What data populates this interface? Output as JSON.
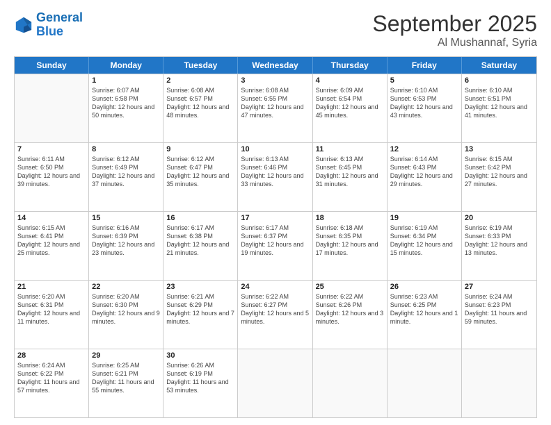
{
  "header": {
    "logo_line1": "General",
    "logo_line2": "Blue",
    "month": "September 2025",
    "location": "Al Mushannaf, Syria"
  },
  "days_of_week": [
    "Sunday",
    "Monday",
    "Tuesday",
    "Wednesday",
    "Thursday",
    "Friday",
    "Saturday"
  ],
  "weeks": [
    [
      {
        "day": "",
        "sunrise": "",
        "sunset": "",
        "daylight": ""
      },
      {
        "day": "1",
        "sunrise": "Sunrise: 6:07 AM",
        "sunset": "Sunset: 6:58 PM",
        "daylight": "Daylight: 12 hours and 50 minutes."
      },
      {
        "day": "2",
        "sunrise": "Sunrise: 6:08 AM",
        "sunset": "Sunset: 6:57 PM",
        "daylight": "Daylight: 12 hours and 48 minutes."
      },
      {
        "day": "3",
        "sunrise": "Sunrise: 6:08 AM",
        "sunset": "Sunset: 6:55 PM",
        "daylight": "Daylight: 12 hours and 47 minutes."
      },
      {
        "day": "4",
        "sunrise": "Sunrise: 6:09 AM",
        "sunset": "Sunset: 6:54 PM",
        "daylight": "Daylight: 12 hours and 45 minutes."
      },
      {
        "day": "5",
        "sunrise": "Sunrise: 6:10 AM",
        "sunset": "Sunset: 6:53 PM",
        "daylight": "Daylight: 12 hours and 43 minutes."
      },
      {
        "day": "6",
        "sunrise": "Sunrise: 6:10 AM",
        "sunset": "Sunset: 6:51 PM",
        "daylight": "Daylight: 12 hours and 41 minutes."
      }
    ],
    [
      {
        "day": "7",
        "sunrise": "Sunrise: 6:11 AM",
        "sunset": "Sunset: 6:50 PM",
        "daylight": "Daylight: 12 hours and 39 minutes."
      },
      {
        "day": "8",
        "sunrise": "Sunrise: 6:12 AM",
        "sunset": "Sunset: 6:49 PM",
        "daylight": "Daylight: 12 hours and 37 minutes."
      },
      {
        "day": "9",
        "sunrise": "Sunrise: 6:12 AM",
        "sunset": "Sunset: 6:47 PM",
        "daylight": "Daylight: 12 hours and 35 minutes."
      },
      {
        "day": "10",
        "sunrise": "Sunrise: 6:13 AM",
        "sunset": "Sunset: 6:46 PM",
        "daylight": "Daylight: 12 hours and 33 minutes."
      },
      {
        "day": "11",
        "sunrise": "Sunrise: 6:13 AM",
        "sunset": "Sunset: 6:45 PM",
        "daylight": "Daylight: 12 hours and 31 minutes."
      },
      {
        "day": "12",
        "sunrise": "Sunrise: 6:14 AM",
        "sunset": "Sunset: 6:43 PM",
        "daylight": "Daylight: 12 hours and 29 minutes."
      },
      {
        "day": "13",
        "sunrise": "Sunrise: 6:15 AM",
        "sunset": "Sunset: 6:42 PM",
        "daylight": "Daylight: 12 hours and 27 minutes."
      }
    ],
    [
      {
        "day": "14",
        "sunrise": "Sunrise: 6:15 AM",
        "sunset": "Sunset: 6:41 PM",
        "daylight": "Daylight: 12 hours and 25 minutes."
      },
      {
        "day": "15",
        "sunrise": "Sunrise: 6:16 AM",
        "sunset": "Sunset: 6:39 PM",
        "daylight": "Daylight: 12 hours and 23 minutes."
      },
      {
        "day": "16",
        "sunrise": "Sunrise: 6:17 AM",
        "sunset": "Sunset: 6:38 PM",
        "daylight": "Daylight: 12 hours and 21 minutes."
      },
      {
        "day": "17",
        "sunrise": "Sunrise: 6:17 AM",
        "sunset": "Sunset: 6:37 PM",
        "daylight": "Daylight: 12 hours and 19 minutes."
      },
      {
        "day": "18",
        "sunrise": "Sunrise: 6:18 AM",
        "sunset": "Sunset: 6:35 PM",
        "daylight": "Daylight: 12 hours and 17 minutes."
      },
      {
        "day": "19",
        "sunrise": "Sunrise: 6:19 AM",
        "sunset": "Sunset: 6:34 PM",
        "daylight": "Daylight: 12 hours and 15 minutes."
      },
      {
        "day": "20",
        "sunrise": "Sunrise: 6:19 AM",
        "sunset": "Sunset: 6:33 PM",
        "daylight": "Daylight: 12 hours and 13 minutes."
      }
    ],
    [
      {
        "day": "21",
        "sunrise": "Sunrise: 6:20 AM",
        "sunset": "Sunset: 6:31 PM",
        "daylight": "Daylight: 12 hours and 11 minutes."
      },
      {
        "day": "22",
        "sunrise": "Sunrise: 6:20 AM",
        "sunset": "Sunset: 6:30 PM",
        "daylight": "Daylight: 12 hours and 9 minutes."
      },
      {
        "day": "23",
        "sunrise": "Sunrise: 6:21 AM",
        "sunset": "Sunset: 6:29 PM",
        "daylight": "Daylight: 12 hours and 7 minutes."
      },
      {
        "day": "24",
        "sunrise": "Sunrise: 6:22 AM",
        "sunset": "Sunset: 6:27 PM",
        "daylight": "Daylight: 12 hours and 5 minutes."
      },
      {
        "day": "25",
        "sunrise": "Sunrise: 6:22 AM",
        "sunset": "Sunset: 6:26 PM",
        "daylight": "Daylight: 12 hours and 3 minutes."
      },
      {
        "day": "26",
        "sunrise": "Sunrise: 6:23 AM",
        "sunset": "Sunset: 6:25 PM",
        "daylight": "Daylight: 12 hours and 1 minute."
      },
      {
        "day": "27",
        "sunrise": "Sunrise: 6:24 AM",
        "sunset": "Sunset: 6:23 PM",
        "daylight": "Daylight: 11 hours and 59 minutes."
      }
    ],
    [
      {
        "day": "28",
        "sunrise": "Sunrise: 6:24 AM",
        "sunset": "Sunset: 6:22 PM",
        "daylight": "Daylight: 11 hours and 57 minutes."
      },
      {
        "day": "29",
        "sunrise": "Sunrise: 6:25 AM",
        "sunset": "Sunset: 6:21 PM",
        "daylight": "Daylight: 11 hours and 55 minutes."
      },
      {
        "day": "30",
        "sunrise": "Sunrise: 6:26 AM",
        "sunset": "Sunset: 6:19 PM",
        "daylight": "Daylight: 11 hours and 53 minutes."
      },
      {
        "day": "",
        "sunrise": "",
        "sunset": "",
        "daylight": ""
      },
      {
        "day": "",
        "sunrise": "",
        "sunset": "",
        "daylight": ""
      },
      {
        "day": "",
        "sunrise": "",
        "sunset": "",
        "daylight": ""
      },
      {
        "day": "",
        "sunrise": "",
        "sunset": "",
        "daylight": ""
      }
    ]
  ]
}
